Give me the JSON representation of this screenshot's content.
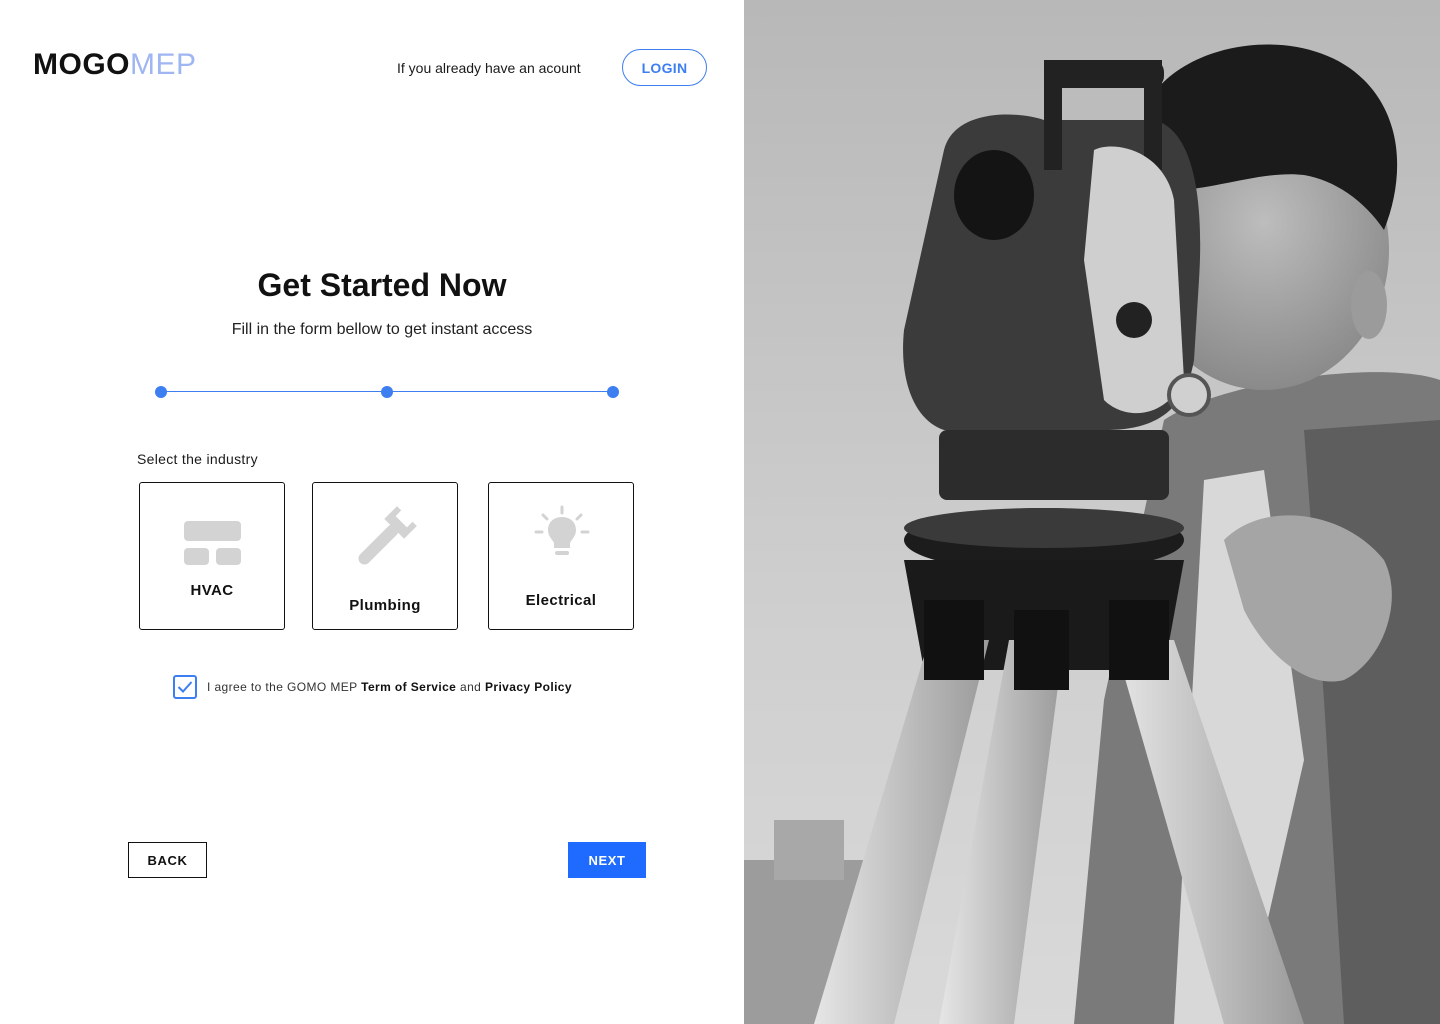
{
  "brand": {
    "part1": "MOGO",
    "part2": "MEP",
    "accent_color": "#9fb6f2"
  },
  "header": {
    "have_account_text": "If you already have an acount",
    "login_label": "LOGIN"
  },
  "main": {
    "title": "Get Started Now",
    "subtitle": "Fill in the form bellow to get instant access",
    "stepper": {
      "steps": 3
    },
    "industry_label": "Select the industry",
    "industries": [
      {
        "label": "HVAC",
        "icon": "hvac-icon"
      },
      {
        "label": "Plumbing",
        "icon": "wrench-icon"
      },
      {
        "label": "Electrical",
        "icon": "lightbulb-icon"
      }
    ],
    "agreement": {
      "checked": true,
      "prefix": "I agree to the GOMO MEP ",
      "terms": "Term of Service",
      "and": " and ",
      "privacy": "Privacy Policy"
    }
  },
  "footer": {
    "back_label": "BACK",
    "next_label": "NEXT"
  },
  "colors": {
    "primary": "#1f6bff",
    "link": "#3d7ef0",
    "icon_gray": "#d3d3d3"
  },
  "hero_image": {
    "description_icon": "surveyor-photo"
  }
}
